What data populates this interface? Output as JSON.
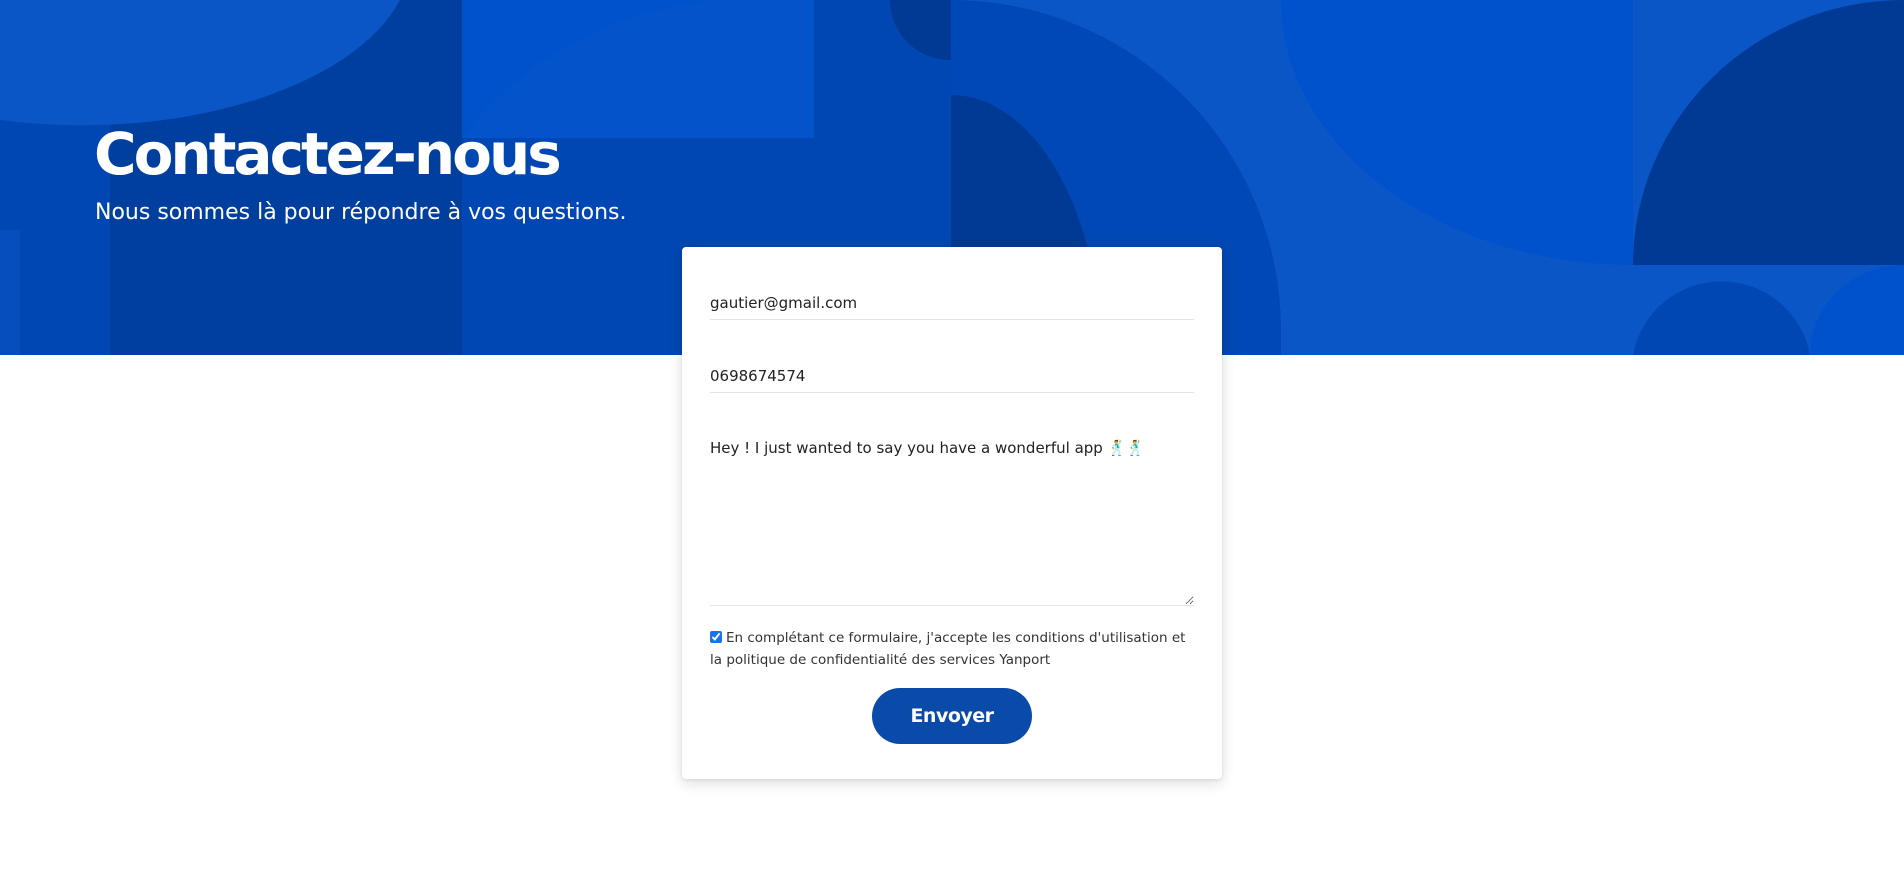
{
  "hero": {
    "title": "Contactez-nous",
    "subtitle": "Nous sommes là pour répondre à vos questions."
  },
  "form": {
    "email_value": "gautier@gmail.com",
    "phone_value": "0698674574",
    "message_value": "Hey ! I just wanted to say you have a wonderful app 🕺🕺",
    "consent_checked": true,
    "consent_text": "En complétant ce formulaire, j'accepte les conditions d'utilisation et la politique de confidentialité des services Yanport",
    "submit_label": "Envoyer"
  },
  "colors": {
    "hero_blue": "#0047b3",
    "button_blue": "#0a4aa8",
    "text": "#222222"
  }
}
